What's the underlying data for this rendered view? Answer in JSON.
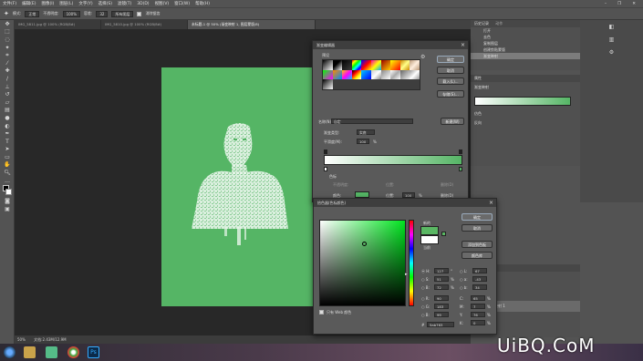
{
  "menubar": {
    "items": [
      "文件(F)",
      "编辑(E)",
      "图像(I)",
      "图层(L)",
      "文字(Y)",
      "选择(S)",
      "滤镜(T)",
      "3D(D)",
      "视图(V)",
      "窗口(W)",
      "帮助(H)"
    ]
  },
  "window_controls": {
    "minimize": "–",
    "restore": "❐",
    "close": "✕"
  },
  "options_bar": {
    "mode_label": "模式:",
    "mode_value": "正常",
    "opacity_label": "不透明度:",
    "opacity_value": "100%",
    "tolerance_label": "容差:",
    "tolerance_value": "32",
    "sample_value": "所有图层",
    "checkbox_label": "消除锯齿"
  },
  "document_tabs": [
    {
      "label": "IMG_5811.jpg @ 100% (RGB/8#)"
    },
    {
      "label": "IMG_5810.jpg @ 100% (RGB/8#)"
    },
    {
      "label": "未标题-1 @ 50% (渐变映射 1, 图层蒙版/8)"
    }
  ],
  "statusbar": {
    "zoom": "50%",
    "doc": "文档:2.43M/12.9M"
  },
  "history_panel": {
    "tab1": "历史记录",
    "tab2": "动作",
    "items": [
      "打开",
      "去色",
      "复制图层",
      "创建剪贴蒙版",
      "渐变映射"
    ]
  },
  "properties_panel": {
    "title": "属性",
    "subtitle": "渐变映射",
    "opt1": "仿色",
    "opt2": "反向"
  },
  "layers_panel": {
    "tab": "图层",
    "layer_name": "渐变映射 1"
  },
  "gradient_editor": {
    "title": "渐变编辑器",
    "presets_label": "预设",
    "ok": "确定",
    "cancel": "取消",
    "load": "载入(L)...",
    "save": "存储(S)...",
    "name_label": "名称(N):",
    "name_value": "自定",
    "new_button": "新建(W)",
    "type_label": "渐变类型:",
    "type_value": "实底",
    "smooth_label": "平滑度(M):",
    "smooth_value": "100",
    "smooth_unit": "%",
    "stops_label": "色标",
    "opacity_label": "不透明度:",
    "location_label": "位置:",
    "delete_label": "删除(D)",
    "color_label": "颜色:",
    "location_value": "100",
    "location_unit": "%",
    "delete_label2": "删除(D)"
  },
  "color_picker": {
    "title": "拾色器(色标颜色)",
    "ok": "确定",
    "cancel": "取消",
    "add_swatch": "添加到色板",
    "libraries": "颜色库",
    "new_label": "新的",
    "current_label": "当前",
    "web_only": "只有 Web 颜色",
    "hsb": {
      "H": "127",
      "S": "51",
      "B": "72"
    },
    "rgb": {
      "R": "90",
      "G": "183",
      "B": "99"
    },
    "lab": {
      "L": "67",
      "a": "-43",
      "b": "34"
    },
    "cmyk": {
      "C": "65",
      "M": "7",
      "Y": "76",
      "K": "0"
    },
    "hex": "5ab763",
    "units": {
      "deg": "°",
      "pct": "%"
    },
    "new_color": "#5ab763",
    "current_color": "#ffffff"
  },
  "taskbar": {
    "time": "",
    "apps": [
      "explorer",
      "folder",
      "chrome",
      "player",
      "photoshop"
    ]
  },
  "watermark": "UiBQ.CoM",
  "colors": {
    "accent": "#55b565",
    "panel": "#535353",
    "canvas": "#282828"
  }
}
